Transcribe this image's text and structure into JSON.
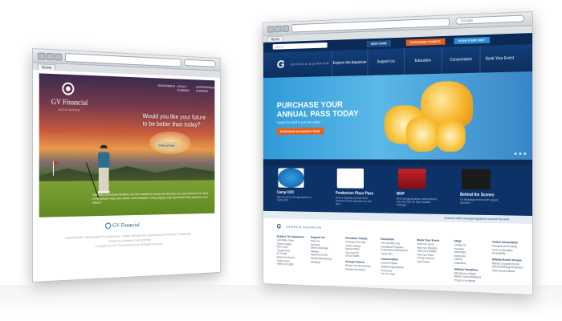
{
  "left_site": {
    "tab_label": "Home",
    "logo_name": "GV Financial",
    "logo_sub": "ADVISORS",
    "nav": [
      "INVESTMENTS",
      "LEGACY PLANNING",
      "ENTREPRENEURIAL PLANNING"
    ],
    "headline": "Would you like your future to be better than today?",
    "cta": "Find out how",
    "quote": "\"We help successful families use their wealth to create the life they love and enhance the lives of the people they care about, and establish a living legacy that represents their passions and values.\"",
    "footer_logo": "GV Financial",
    "footer_line1": "Guided Wealth Transformation™ | Investments | Legacy Management | Entrepreneurial Planning | Philanthropy",
    "footer_line2": "Contact Us | Business Card | Sitemap",
    "footer_line3": "Copyright 2010 GV Financial Advisors. All Rights Reserved."
  },
  "right_site": {
    "google_placeholder": "Google",
    "tab_label": "Home",
    "top_search_placeholder": "Search",
    "top_buttons": [
      "NEW CAMS",
      "PURCHASE TICKETS",
      "PLAN YOUR VISIT"
    ],
    "logo_text": "GEORGIA AQUARIUM",
    "nav": [
      "Explore the Aquarium",
      "Support Us",
      "Education",
      "Conservation",
      "Book Your Event"
    ],
    "hero_title": "PURCHASE YOUR ANNUAL PASS TODAY",
    "hero_subtitle": "It pays for itself in just two visits!",
    "hero_button": "PURCHASE AN ANNUAL PASS",
    "latest_label": "Latest News",
    "cards": [
      {
        "title": "Camp H2O",
        "desc": "Sign up now for Georgia Aquarium's Camp H2O!",
        "thumb": "Camp H2O"
      },
      {
        "title": "Pemberton Place Pass",
        "desc": "See the Aquarium and two other Pemberton Place attractions for one price.",
        "thumb": "Pemberton Place"
      },
      {
        "title": "MVP",
        "desc": "New Georgia Aquarium, Atlanta Braves and more with the Most Valuable Package!",
        "thumb": "MVP"
      },
      {
        "title": "Behind the Scenes",
        "desc": "Go backstage at the world's largest aquarium.",
        "thumb": "BEHIND THE SCENES"
      }
    ],
    "signup": "Sign Up for our Newsletter",
    "connect": "Connect with Georgia Aquarium around the web",
    "footer_logo_text": "GEORGIA AQUARIUM",
    "footer_cols": [
      {
        "head": "Explore The Aquarium",
        "links": [
          "Cold Water Quest",
          "Ocean Voyager",
          "River Scout",
          "Tropical Diver",
          "4D Theater",
          "Behind the Scenes",
          "Gallery Tours",
          "Hotel Love Lights"
        ]
      },
      {
        "head": "Support Us",
        "links": [
          "About Us",
          "Sponsors",
          "Store & Beverage",
          "Affiliates",
          "Aquarium Events",
          "Sentimental Meetings",
          "Weddings"
        ]
      },
      {
        "head": "Purchase Tickets",
        "links": [
          "Purchase Plus Pass",
          "Online Catalog",
          "Special Offers",
          "Your Account",
          "Group Tickets"
        ],
        "head2": "Annual Passes",
        "links2": [
          "Renew Your Annual Pass",
          "Member Information"
        ]
      },
      {
        "head": "Education",
        "links": [
          "The Learning Loop",
          "Educational Programs",
          "Professional Development",
          "Camp H2O"
        ],
        "head2": "Conservation",
        "links2": [
          "Current Projects",
          "Related Organizations",
          "Resources",
          "You Can Help"
        ]
      },
      {
        "head": "Book Your Event",
        "links": [
          "Host Your Event",
          "Host Your Wedding",
          "View Our Facilities",
          "Plan Your Event",
          "Pricing & Menus",
          "Past Parties"
        ]
      },
      {
        "head": "FAQs",
        "links": [
          "Contact Us",
          "Volunteer",
          "Internships",
          "Newsroom",
          "Careers",
          "Collections"
        ],
        "head2": "Atlanta Vacations",
        "links2": [
          "Attractions in Atlanta",
          "Atlanta Tourist Attractions",
          "Things to do Atlanta"
        ]
      },
      {
        "head": "Visitor Information",
        "links": [
          "Directions and Parking",
          "Hours of Operation",
          "Accessibility"
        ],
        "head2": "Atlanta Event Venues",
        "links2": [
          "Atlanta Corporate Events",
          "Atlanta Wedding Receptions",
          "Party Venues Atlanta"
        ]
      }
    ]
  },
  "colors": {
    "ga_navy": "#0b2a55",
    "ga_orange": "#e8601c",
    "gv_blue": "#1f4f78"
  }
}
